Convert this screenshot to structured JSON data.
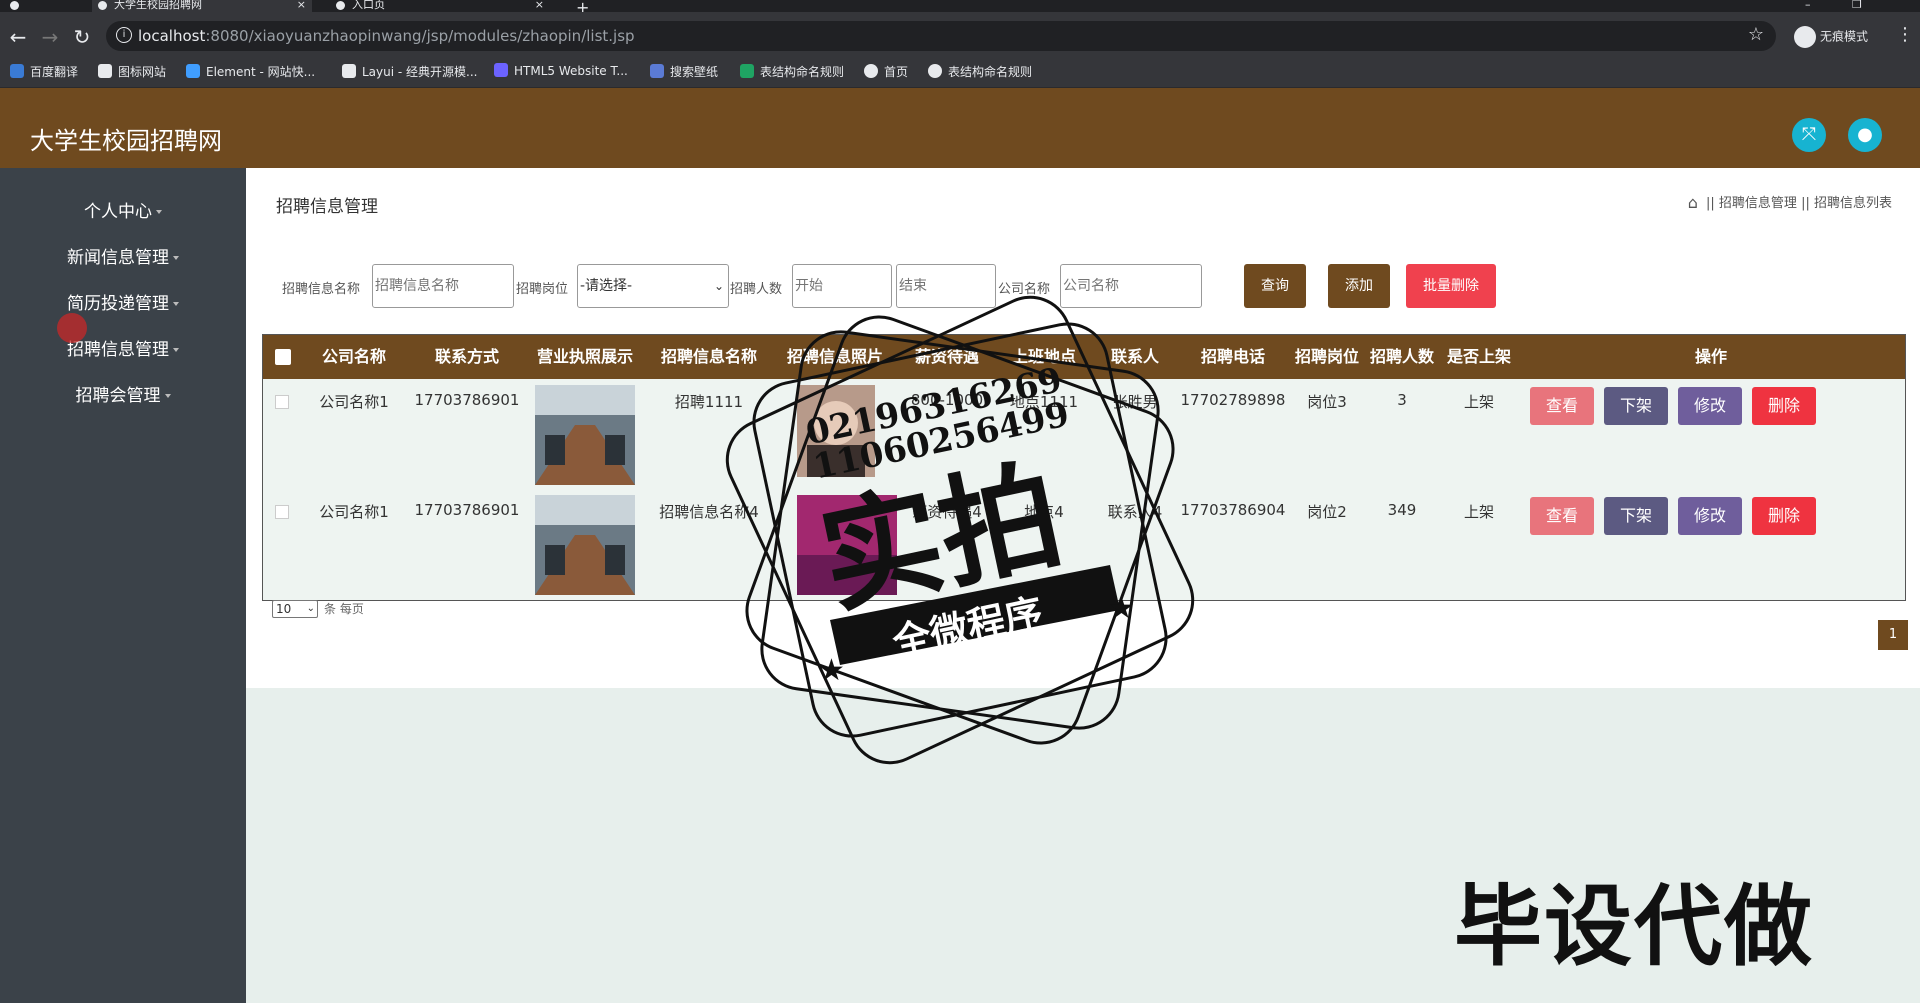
{
  "browser": {
    "tabs": [
      {
        "title": "大学生校园招聘网",
        "active": true
      },
      {
        "title": "入口页",
        "active": false
      }
    ],
    "url_host": "localhost",
    "url_rest": ":8080/xiaoyuanzhaopinwang/jsp/modules/zhaopin/list.jsp",
    "profile_label": "无痕模式",
    "bookmarks": [
      "百度翻译",
      "图标网站",
      "Element - 网站快...",
      "Layui - 经典开源模...",
      "HTML5 Website T...",
      "搜索壁纸",
      "表结构命名规则",
      "首页",
      "表结构命名规则"
    ]
  },
  "app": {
    "title": "大学生校园招聘网"
  },
  "sidebar": {
    "items": [
      {
        "label": "个人中心"
      },
      {
        "label": "新闻信息管理"
      },
      {
        "label": "简历投递管理"
      },
      {
        "label": "招聘信息管理"
      },
      {
        "label": "招聘会管理"
      }
    ]
  },
  "page": {
    "title": "招聘信息管理",
    "breadcrumb": [
      "招聘信息管理",
      "招聘信息列表"
    ],
    "breadcrumb_sep": "||"
  },
  "search": {
    "name_label": "招聘信息名称",
    "name_placeholder": "招聘信息名称",
    "post_label": "招聘岗位",
    "post_value": "-请选择-",
    "count_label": "招聘人数",
    "count_start_placeholder": "开始",
    "count_end_placeholder": "结束",
    "company_label": "公司名称",
    "company_placeholder": "公司名称",
    "query_button": "查询",
    "add_button": "添加",
    "batch_delete_button": "批量删除"
  },
  "table": {
    "columns": [
      "公司名称",
      "联系方式",
      "营业执照展示",
      "招聘信息名称",
      "招聘信息照片",
      "薪资待遇",
      "上班地点",
      "联系人",
      "招聘电话",
      "招聘岗位",
      "招聘人数",
      "是否上架",
      "操作"
    ],
    "rows": [
      {
        "company": "公司名称1",
        "contact": "17703786901",
        "name": "招聘1111",
        "salary": "800-1000",
        "location": "地点1111",
        "contact_person": "张胜男",
        "phone": "17702789898",
        "post": "岗位3",
        "count": "3",
        "listed": "上架"
      },
      {
        "company": "公司名称1",
        "contact": "17703786901",
        "name": "招聘信息名称4",
        "salary": "薪资待遇4",
        "location": "地点4",
        "contact_person": "联系人4",
        "phone": "17703786904",
        "post": "岗位2",
        "count": "349",
        "listed": "上架"
      }
    ],
    "actions": {
      "view": "查看",
      "off_shelf": "下架",
      "edit": "修改",
      "delete": "删除"
    }
  },
  "pager": {
    "page_size": "10",
    "per_page_label": "条 每页",
    "current_page": "1"
  },
  "overlay": {
    "stamp_line1": "02196316269",
    "stamp_line2": "11060256499",
    "stamp_main": "实拍",
    "stamp_banner": "全微程序",
    "corner_text": "毕设代做"
  },
  "colors": {
    "brand_brown": "#6f4a1f",
    "sidebar_bg": "#3b4249",
    "view_btn": "#e8747c",
    "off_shelf_btn": "#5c5a82",
    "edit_btn": "#6f5e9c",
    "delete_btn": "#ef3340",
    "batch_delete_btn": "#f0414e",
    "header_icon": "#17b3d1"
  }
}
